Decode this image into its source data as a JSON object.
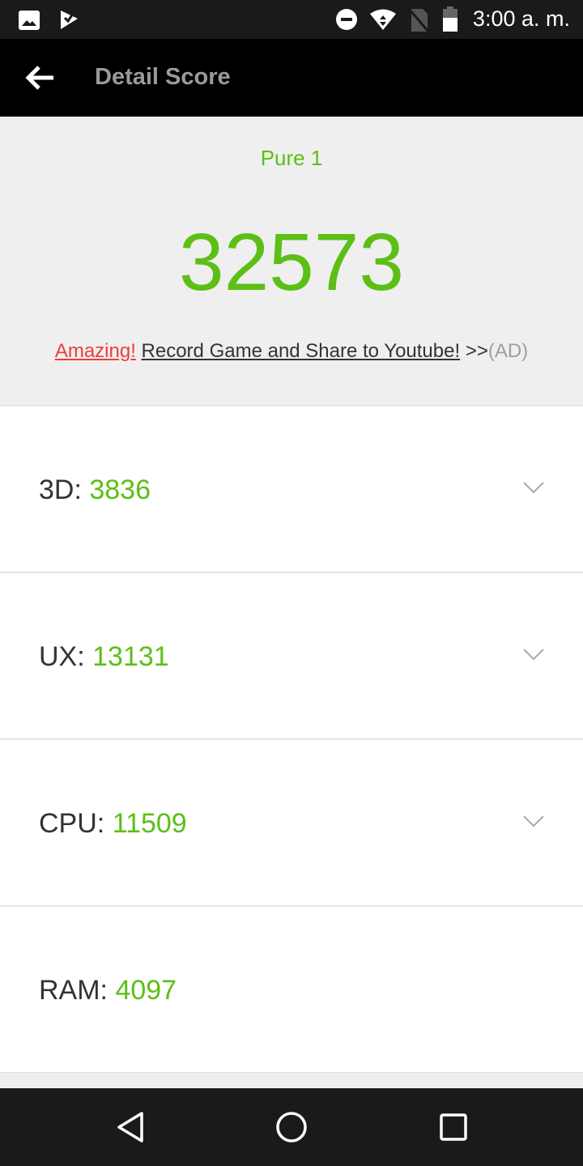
{
  "status_bar": {
    "time": "3:00 a. m.",
    "icons": [
      "image-icon",
      "checklist-icon",
      "do-not-disturb-icon",
      "wifi-icon",
      "no-sim-icon",
      "battery-icon"
    ]
  },
  "header": {
    "title": "Detail Score",
    "back_icon": "arrow-left-icon"
  },
  "summary": {
    "device": "Pure 1",
    "total_score": "32573",
    "ad": {
      "highlight": "Amazing!",
      "text": "Record Game and Share to Youtube!",
      "arrows": ">>",
      "tag": "(AD)"
    }
  },
  "scores": [
    {
      "label": "3D: ",
      "value": "3836",
      "expandable": true
    },
    {
      "label": "UX: ",
      "value": "13131",
      "expandable": true
    },
    {
      "label": "CPU: ",
      "value": "11509",
      "expandable": true
    },
    {
      "label": "RAM: ",
      "value": "4097",
      "expandable": false
    }
  ],
  "colors": {
    "accent": "#5cbf16",
    "ad_highlight": "#f03c3c"
  },
  "nav_bar": {
    "icons": [
      "back-triangle-icon",
      "home-circle-icon",
      "recents-square-icon"
    ]
  }
}
